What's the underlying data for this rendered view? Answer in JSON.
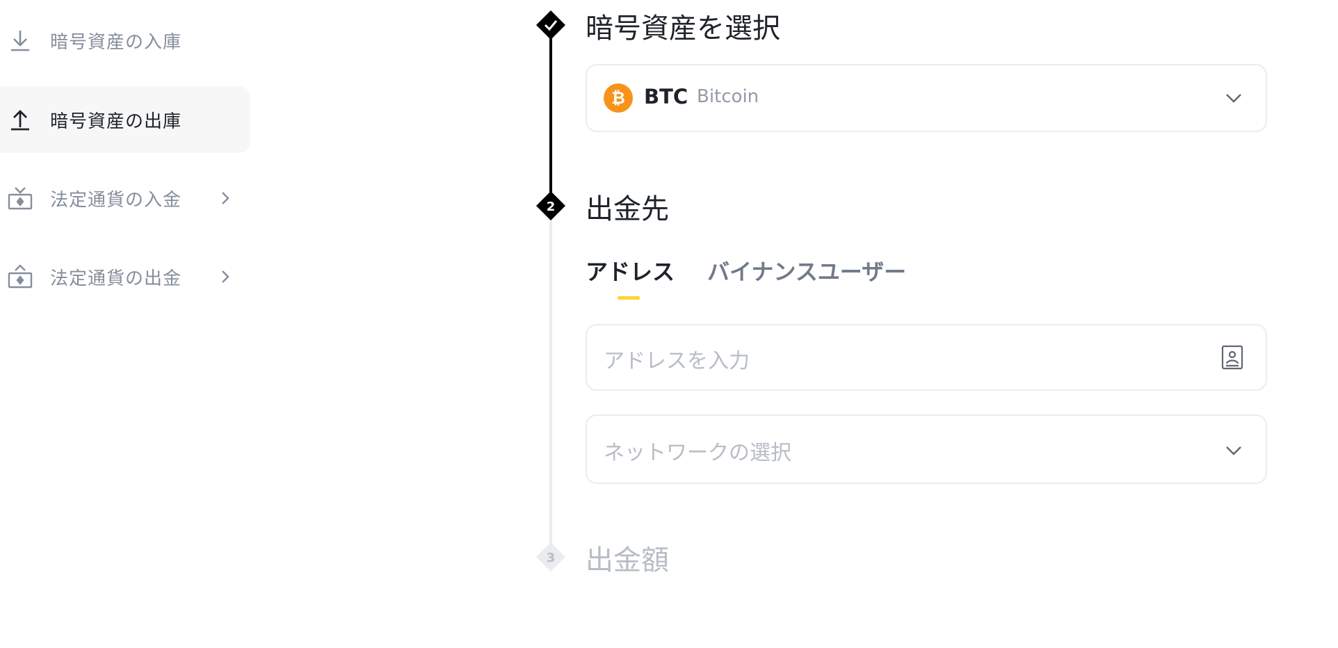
{
  "sidebar": {
    "items": [
      {
        "label": "暗号資産の入庫",
        "icon": "download-icon",
        "active": false
      },
      {
        "label": "暗号資産の出庫",
        "icon": "upload-icon",
        "active": true
      },
      {
        "label": "法定通貨の入金",
        "icon": "fiat-deposit-icon",
        "has_chevron": true
      },
      {
        "label": "法定通貨の出金",
        "icon": "fiat-withdraw-icon",
        "has_chevron": true
      }
    ]
  },
  "steps": [
    {
      "number": "",
      "title": "暗号資産を選択",
      "state": "completed"
    },
    {
      "number": "2",
      "title": "出金先",
      "state": "active"
    },
    {
      "number": "3",
      "title": "出金額",
      "state": "disabled"
    }
  ],
  "coin_select": {
    "symbol": "BTC",
    "name": "Bitcoin",
    "icon_glyph": "₿",
    "icon_color": "#f7931a"
  },
  "destination": {
    "tabs": [
      {
        "label": "アドレス",
        "active": true
      },
      {
        "label": "バイナンスユーザー",
        "active": false
      }
    ],
    "address_placeholder": "アドレスを入力",
    "network_placeholder": "ネットワークの選択"
  },
  "colors": {
    "accent": "#fcd535",
    "active_text": "#1e2329",
    "muted_text": "#848e9c",
    "disabled": "#b7bdc6"
  }
}
